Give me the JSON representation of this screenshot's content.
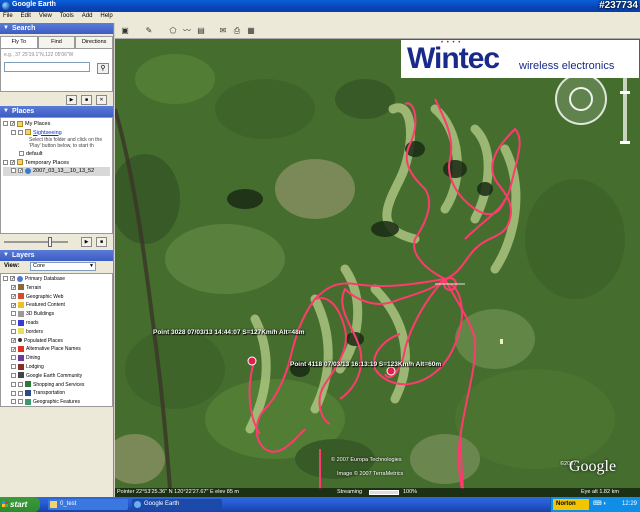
{
  "window": {
    "title": "Google Earth",
    "overlay_id": "#237734"
  },
  "menu": [
    "File",
    "Edit",
    "View",
    "Tools",
    "Add",
    "Help"
  ],
  "search": {
    "header": "Search",
    "tabs": [
      "Fly To",
      "Find Businesses",
      "Directions"
    ],
    "hint": "e.g., 37 25'19.1\"N,122 05'06\"W",
    "value": ""
  },
  "places": {
    "header": "Places",
    "items": [
      {
        "label": "My Places",
        "level": 0
      },
      {
        "label": "Sightseeing",
        "level": 1
      },
      {
        "label": "Select this folder and click on the 'Play' button below, to start th",
        "level": 2
      },
      {
        "label": "default",
        "level": 1
      },
      {
        "label": "Temporary Places",
        "level": 0
      },
      {
        "label": "2007_03_13__10_13_52",
        "level": 1
      }
    ]
  },
  "layers": {
    "header": "Layers",
    "view_label": "View:",
    "view_value": "Core",
    "items": [
      "Primary Database",
      "Terrain",
      "Geographic Web",
      "Featured Content",
      "3D Buildings",
      "roads",
      "borders",
      "Populated Places",
      "Alternative Place Names",
      "Dining",
      "Lodging",
      "Google Earth Community",
      "Shopping and Services",
      "Transportation",
      "Geographic Features"
    ]
  },
  "map": {
    "logo_brand": "Wintec",
    "logo_sub": "wireless electronics",
    "point1": "Point 3028  07/03/13 14:44:07 S=127Km/h  Alt=48m",
    "point2": "Point 4118  07/03/13 16:13:19 S=123Km/h  Alt=60m",
    "copyright1": "© 2007 Europa Technologies",
    "copyright2": "Image © 2007 TerraMetrics",
    "google_small": "©2007",
    "google_logo": "Google",
    "track_color": "#ff3a6e"
  },
  "statusbar": {
    "pointer": "Pointer  22°53'25.36\" N  120°22'27.67\" E   elev  85 m",
    "streaming": "Streaming",
    "streaming_pct": "100%",
    "eye_alt": "Eye alt    1.82 km"
  },
  "taskbar": {
    "start": "start",
    "tasks": [
      "0_test",
      "Google Earth"
    ],
    "norton": "Norton",
    "clock": "12:29"
  }
}
